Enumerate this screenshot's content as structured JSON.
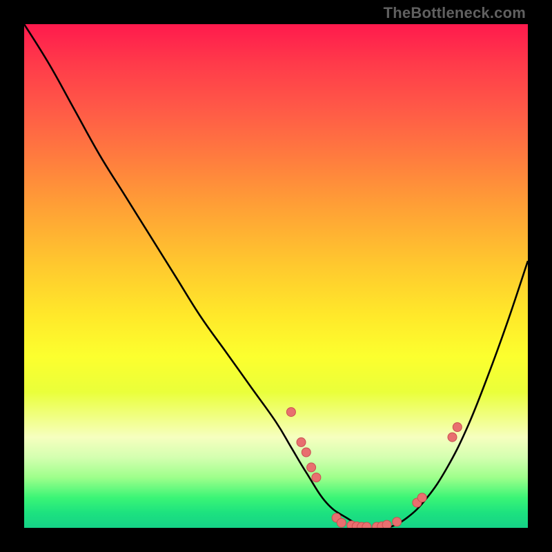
{
  "attribution": "TheBottleneck.com",
  "colors": {
    "frame": "#000000",
    "curve_stroke": "#000000",
    "marker_fill": "#e86f6f",
    "marker_stroke": "#c94f50",
    "gradient_top": "#ff1a4d",
    "gradient_bottom": "#15d287"
  },
  "chart_data": {
    "type": "line",
    "title": "",
    "xlabel": "",
    "ylabel": "",
    "xlim": [
      0,
      100
    ],
    "ylim": [
      0,
      100
    ],
    "grid": false,
    "legend": false,
    "series": [
      {
        "name": "bottleneck-curve",
        "x": [
          0,
          5,
          10,
          15,
          20,
          25,
          30,
          35,
          40,
          45,
          50,
          53,
          56,
          60,
          64,
          68,
          72,
          76,
          80,
          84,
          88,
          92,
          96,
          100
        ],
        "y": [
          100,
          92,
          83,
          74,
          66,
          58,
          50,
          42,
          35,
          28,
          21,
          16,
          11,
          5,
          2,
          0,
          0,
          2,
          6,
          12,
          20,
          30,
          41,
          53
        ]
      }
    ],
    "markers": [
      {
        "x": 53,
        "y": 23
      },
      {
        "x": 55,
        "y": 17
      },
      {
        "x": 56,
        "y": 15
      },
      {
        "x": 57,
        "y": 12
      },
      {
        "x": 58,
        "y": 10
      },
      {
        "x": 62,
        "y": 2
      },
      {
        "x": 63,
        "y": 1
      },
      {
        "x": 65,
        "y": 0.5
      },
      {
        "x": 66,
        "y": 0.3
      },
      {
        "x": 67,
        "y": 0.2
      },
      {
        "x": 68,
        "y": 0.2
      },
      {
        "x": 70,
        "y": 0.2
      },
      {
        "x": 71,
        "y": 0.3
      },
      {
        "x": 72,
        "y": 0.6
      },
      {
        "x": 74,
        "y": 1.2
      },
      {
        "x": 78,
        "y": 5
      },
      {
        "x": 79,
        "y": 6
      },
      {
        "x": 85,
        "y": 18
      },
      {
        "x": 86,
        "y": 20
      }
    ]
  }
}
